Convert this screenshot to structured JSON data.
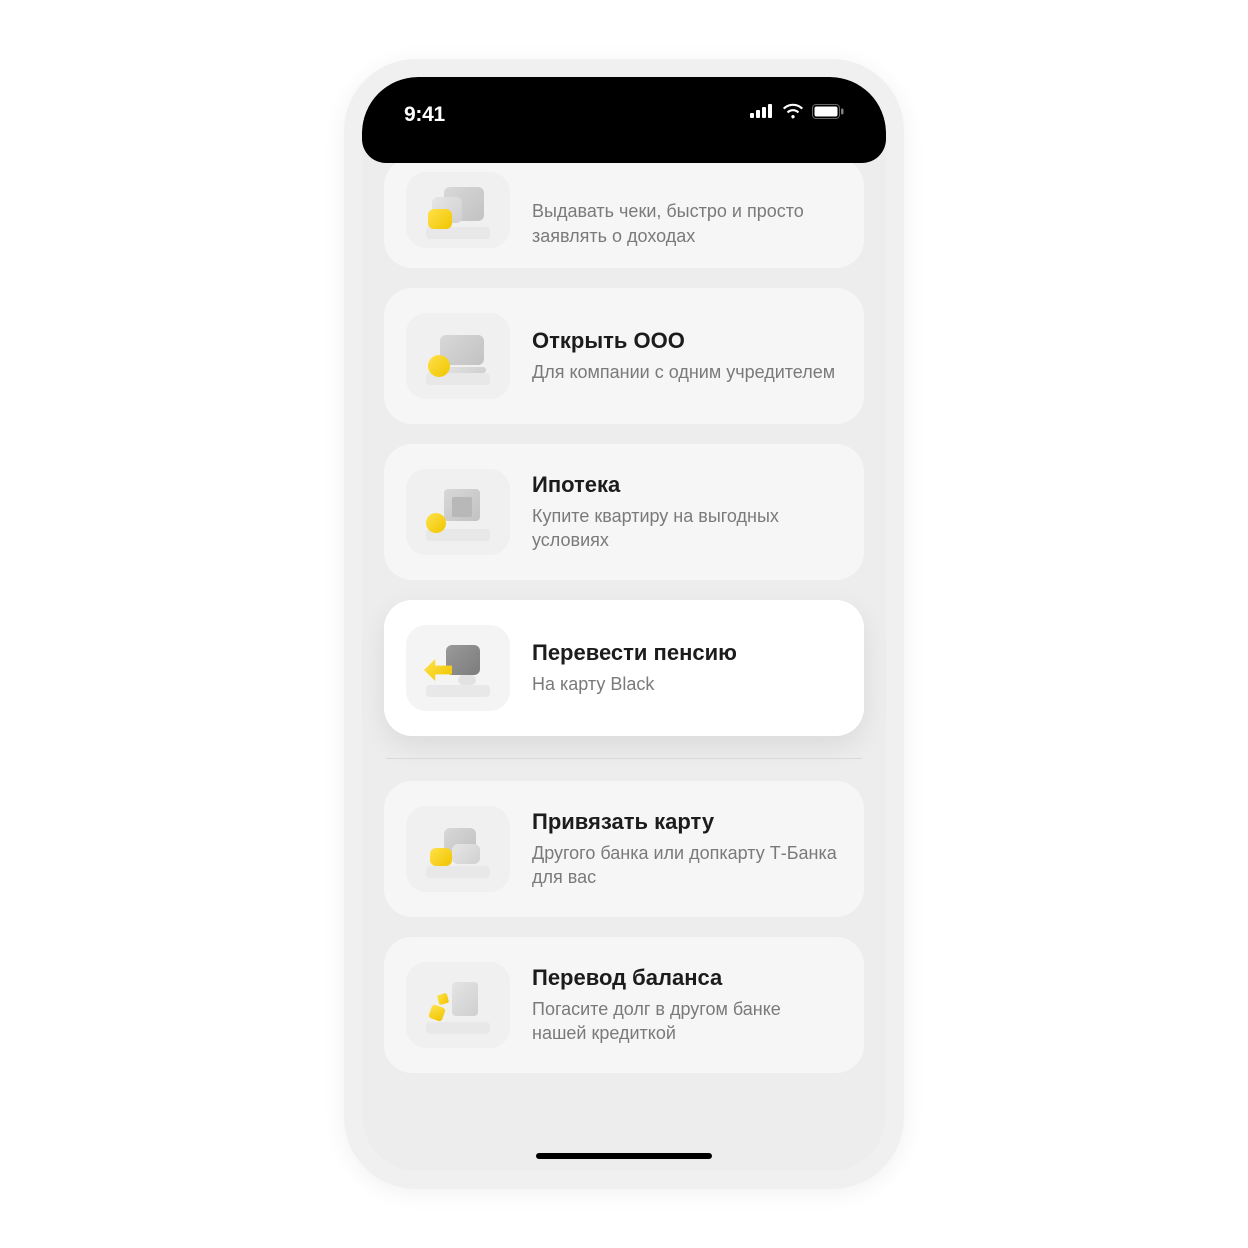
{
  "status": {
    "time": "9:41"
  },
  "cards": [
    {
      "icon": "register-icon",
      "title": "",
      "desc": "Выдавать чеки, быстро и просто заявлять о доходах"
    },
    {
      "icon": "company-icon",
      "title": "Открыть ООО",
      "desc": "Для компании с одним учредителем"
    },
    {
      "icon": "house-icon",
      "title": "Ипотека",
      "desc": "Купите квартиру на выгодных условиях"
    },
    {
      "icon": "pension-icon",
      "title": "Перевести пенсию",
      "desc": "На карту Black"
    },
    {
      "icon": "card-link-icon",
      "title": "Привязать карту",
      "desc": "Другого банка или допкарту Т-Банка для вас"
    },
    {
      "icon": "balance-transfer-icon",
      "title": "Перевод баланса",
      "desc": "Погасите долг в другом банке нашей кредиткой"
    }
  ]
}
